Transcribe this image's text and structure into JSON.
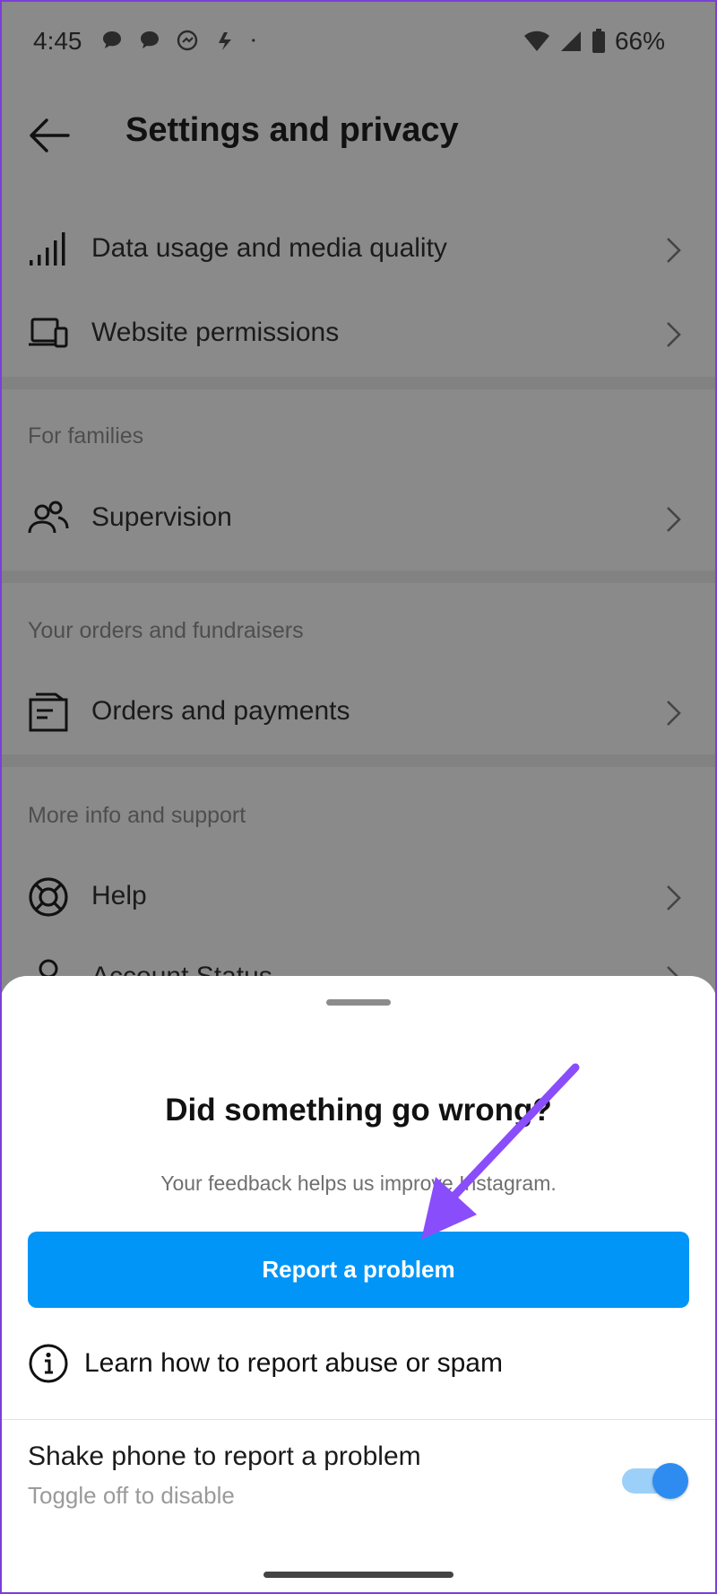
{
  "status_bar": {
    "time": "4:45",
    "battery": "66%",
    "notification_icons": [
      "chat-bubble-icon",
      "chat-bubble-icon",
      "messenger-icon",
      "bolt-app-icon",
      "dot-icon"
    ]
  },
  "header": {
    "title": "Settings and privacy"
  },
  "rows": [
    {
      "label": "Data usage and media quality",
      "icon": "signal-bars-icon"
    },
    {
      "label": "Website permissions",
      "icon": "devices-icon"
    },
    {
      "label": "Supervision",
      "icon": "people-icon"
    },
    {
      "label": "Orders and payments",
      "icon": "receipt-icon"
    },
    {
      "label": "Help",
      "icon": "lifebuoy-icon"
    },
    {
      "label": "Account Status",
      "icon": "person-icon"
    }
  ],
  "sections": {
    "families": "For families",
    "orders": "Your orders and fundraisers",
    "support": "More info and support"
  },
  "sheet": {
    "title": "Did something go wrong?",
    "subtitle": "Your feedback helps us improve Instagram.",
    "report_button": "Report a problem",
    "learn_link": "Learn how to report abuse or spam",
    "shake_title": "Shake phone to report a problem",
    "shake_subtitle": "Toggle off to disable",
    "shake_toggle_on": true
  },
  "colors": {
    "accent": "#0095f6",
    "annotation_arrow": "#8a4dfb",
    "toggle_knob": "#2e8cf0"
  }
}
